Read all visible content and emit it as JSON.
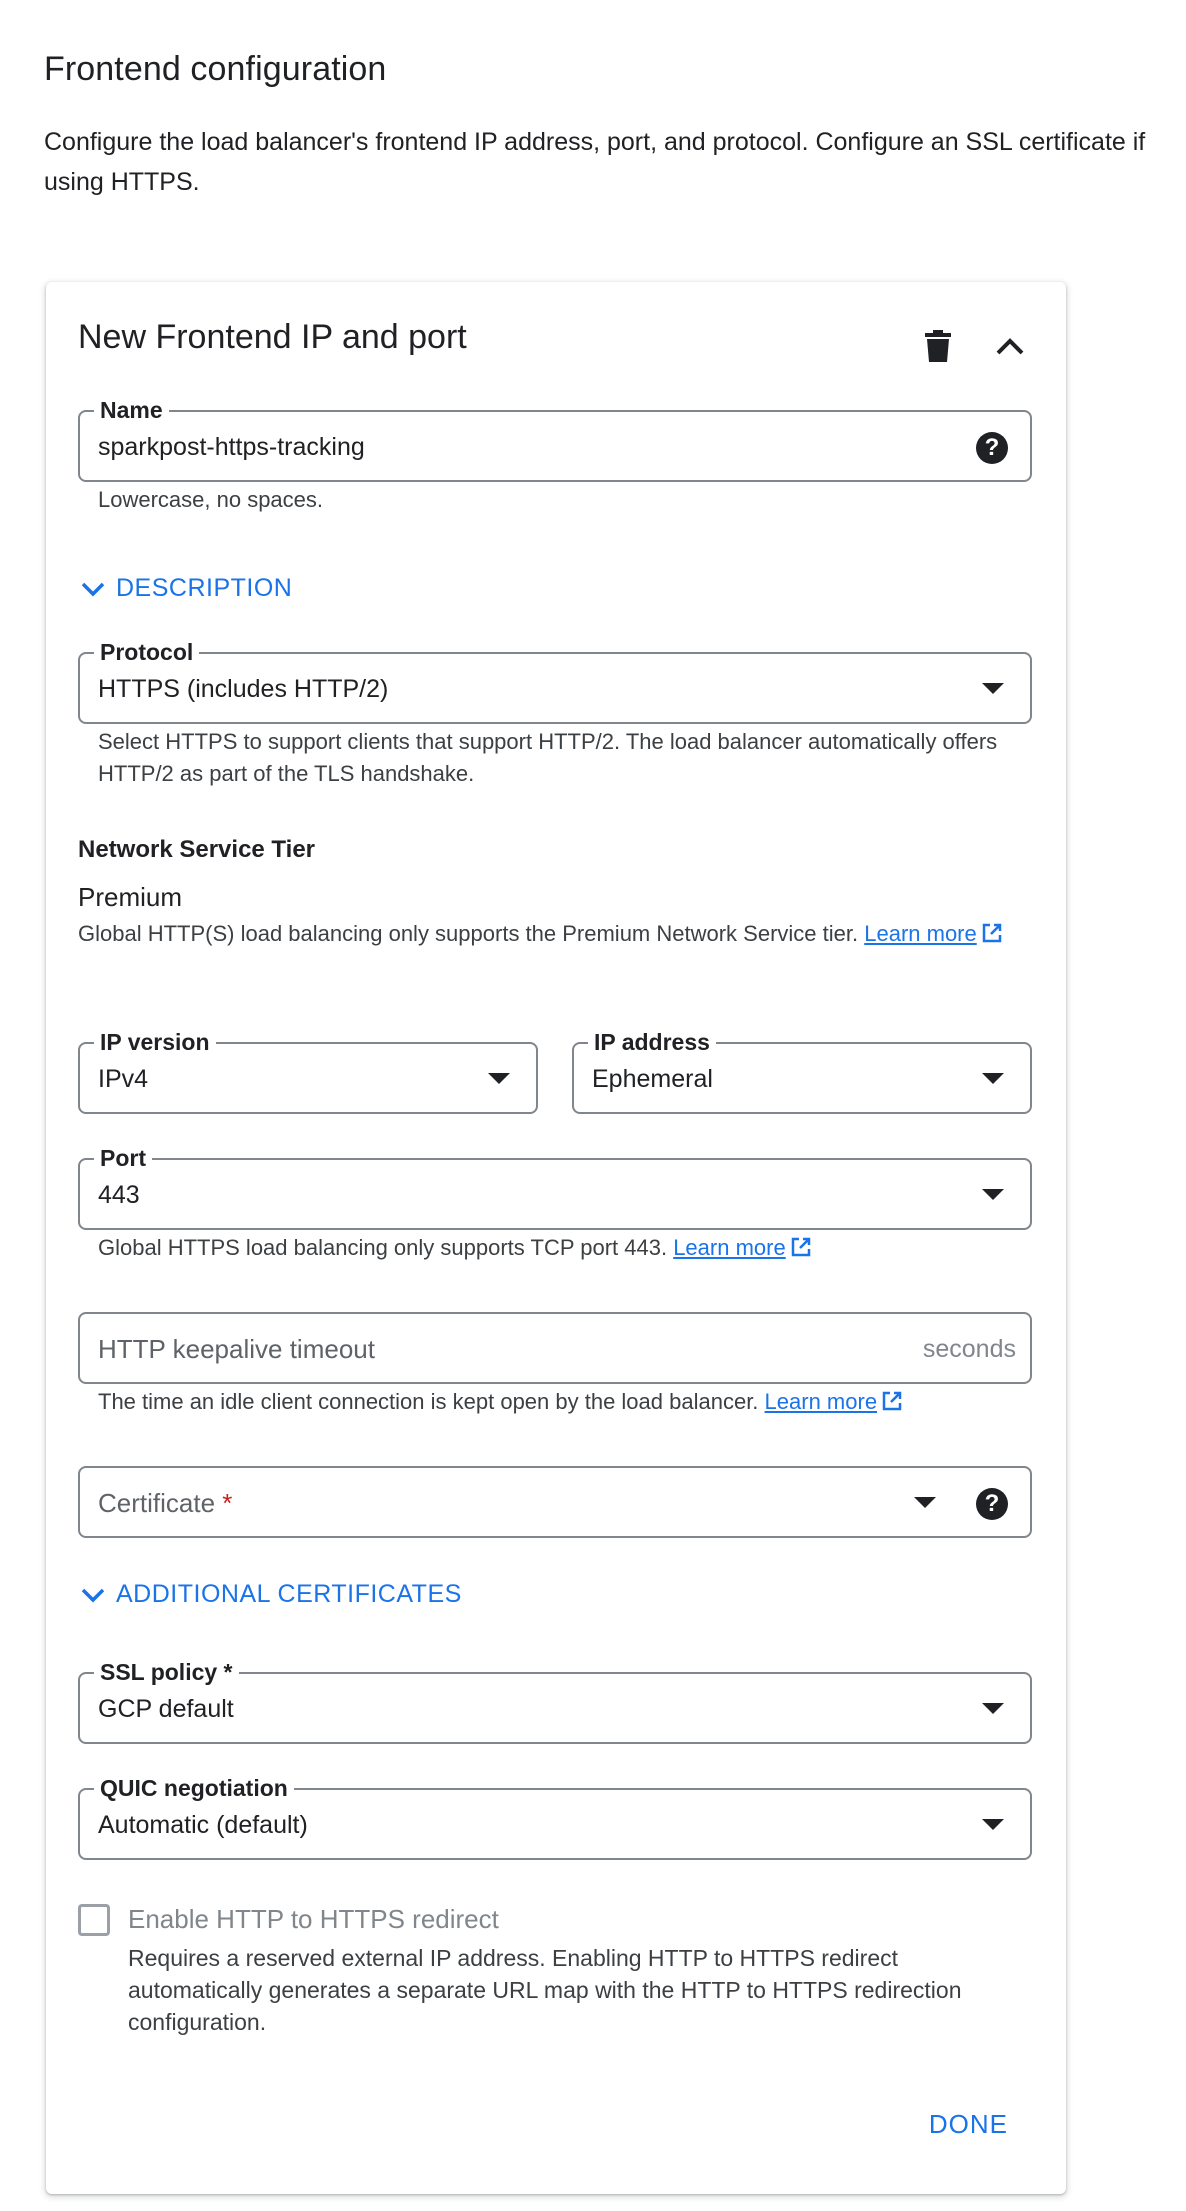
{
  "page": {
    "title": "Frontend configuration",
    "description": "Configure the load balancer's frontend IP address, port, and protocol. Configure an SSL certificate if using HTTPS."
  },
  "card": {
    "title": "New Frontend IP and port",
    "icons": {
      "delete": "delete-icon",
      "collapse": "chevron-up-icon"
    },
    "name_field": {
      "label": "Name",
      "value": "sparkpost-https-tracking",
      "hint": "Lowercase, no spaces."
    },
    "description_toggle": "DESCRIPTION",
    "protocol_field": {
      "label": "Protocol",
      "value": "HTTPS (includes HTTP/2)",
      "hint": "Select HTTPS to support clients that support HTTP/2. The load balancer automatically offers HTTP/2 as part of the TLS handshake."
    },
    "network_tier": {
      "label": "Network Service Tier",
      "value": "Premium",
      "hint": "Global HTTP(S) load balancing only supports the Premium Network Service tier.",
      "link": "Learn more"
    },
    "ip_version_field": {
      "label": "IP version",
      "value": "IPv4"
    },
    "ip_address_field": {
      "label": "IP address",
      "value": "Ephemeral"
    },
    "port_field": {
      "label": "Port",
      "value": "443",
      "hint": "Global HTTPS load balancing only supports TCP port 443.",
      "link": "Learn more"
    },
    "keepalive_field": {
      "placeholder": "HTTP keepalive timeout",
      "suffix": "seconds",
      "hint": "The time an idle client connection is kept open by the load balancer.",
      "link": "Learn more"
    },
    "certificate_field": {
      "placeholder": "Certificate",
      "required_mark": "*"
    },
    "additional_certs_toggle": "ADDITIONAL CERTIFICATES",
    "ssl_policy_field": {
      "label": "SSL policy *",
      "value": "GCP default"
    },
    "quic_field": {
      "label": "QUIC negotiation",
      "value": "Automatic (default)"
    },
    "redirect": {
      "label": "Enable HTTP to HTTPS redirect",
      "checked": false,
      "description": "Requires a reserved external IP address. Enabling HTTP to HTTPS redirect automatically generates a separate URL map with the HTTP to HTTPS redirection configuration."
    },
    "done_label": "DONE"
  },
  "colors": {
    "accent": "#1a73e8",
    "text": "#202124",
    "border": "#80868b",
    "required": "#c5221f"
  }
}
